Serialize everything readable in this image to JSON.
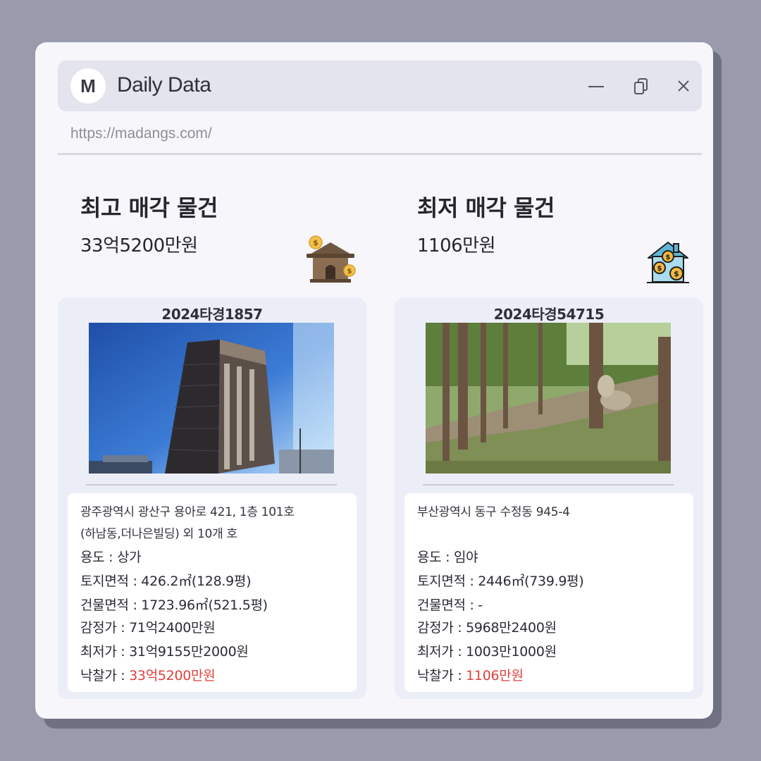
{
  "window": {
    "logo_letter": "M",
    "title": "Daily Data",
    "url": "https://madangs.com/"
  },
  "highest": {
    "heading": "최고 매각 물건",
    "price": "33억5200만원",
    "icon": "house-with-coins-icon",
    "case_no": "2024타경1857",
    "photo": "building-photo",
    "address_line1": "광주광역시 광산구 용아로 421, 1층 101호",
    "address_line2": "(하남동,더나은빌딩) 외 10개 호",
    "usage": "용도 : 상가",
    "land_area": "토지면적 : 426.2㎡(128.9평)",
    "building_area": "건물면적 : 1723.96㎡(521.5평)",
    "appraisal": "감정가 : 71억2400만원",
    "minimum": "최저가 : 31억9155만2000원",
    "winning_label": "낙찰가 : ",
    "winning_value": "33억5200만원"
  },
  "lowest": {
    "heading": "최저 매각 물건",
    "price": "1106만원",
    "icon": "home-money-icon",
    "case_no": "2024타경54715",
    "photo": "forest-photo",
    "address_line1": "부산광역시 동구 수정동 945-4",
    "address_line2": "",
    "usage": "용도 : 임야",
    "land_area": "토지면적 : 2446㎡(739.9평)",
    "building_area": "건물면적 : -",
    "appraisal": "감정가 : 5968만2400원",
    "minimum": "최저가 : 1003만1000원",
    "winning_label": "낙찰가 : ",
    "winning_value": "1106만원"
  },
  "colors": {
    "highlight": "#e0413b",
    "background": "#999bad",
    "window": "#f6f6fb"
  }
}
